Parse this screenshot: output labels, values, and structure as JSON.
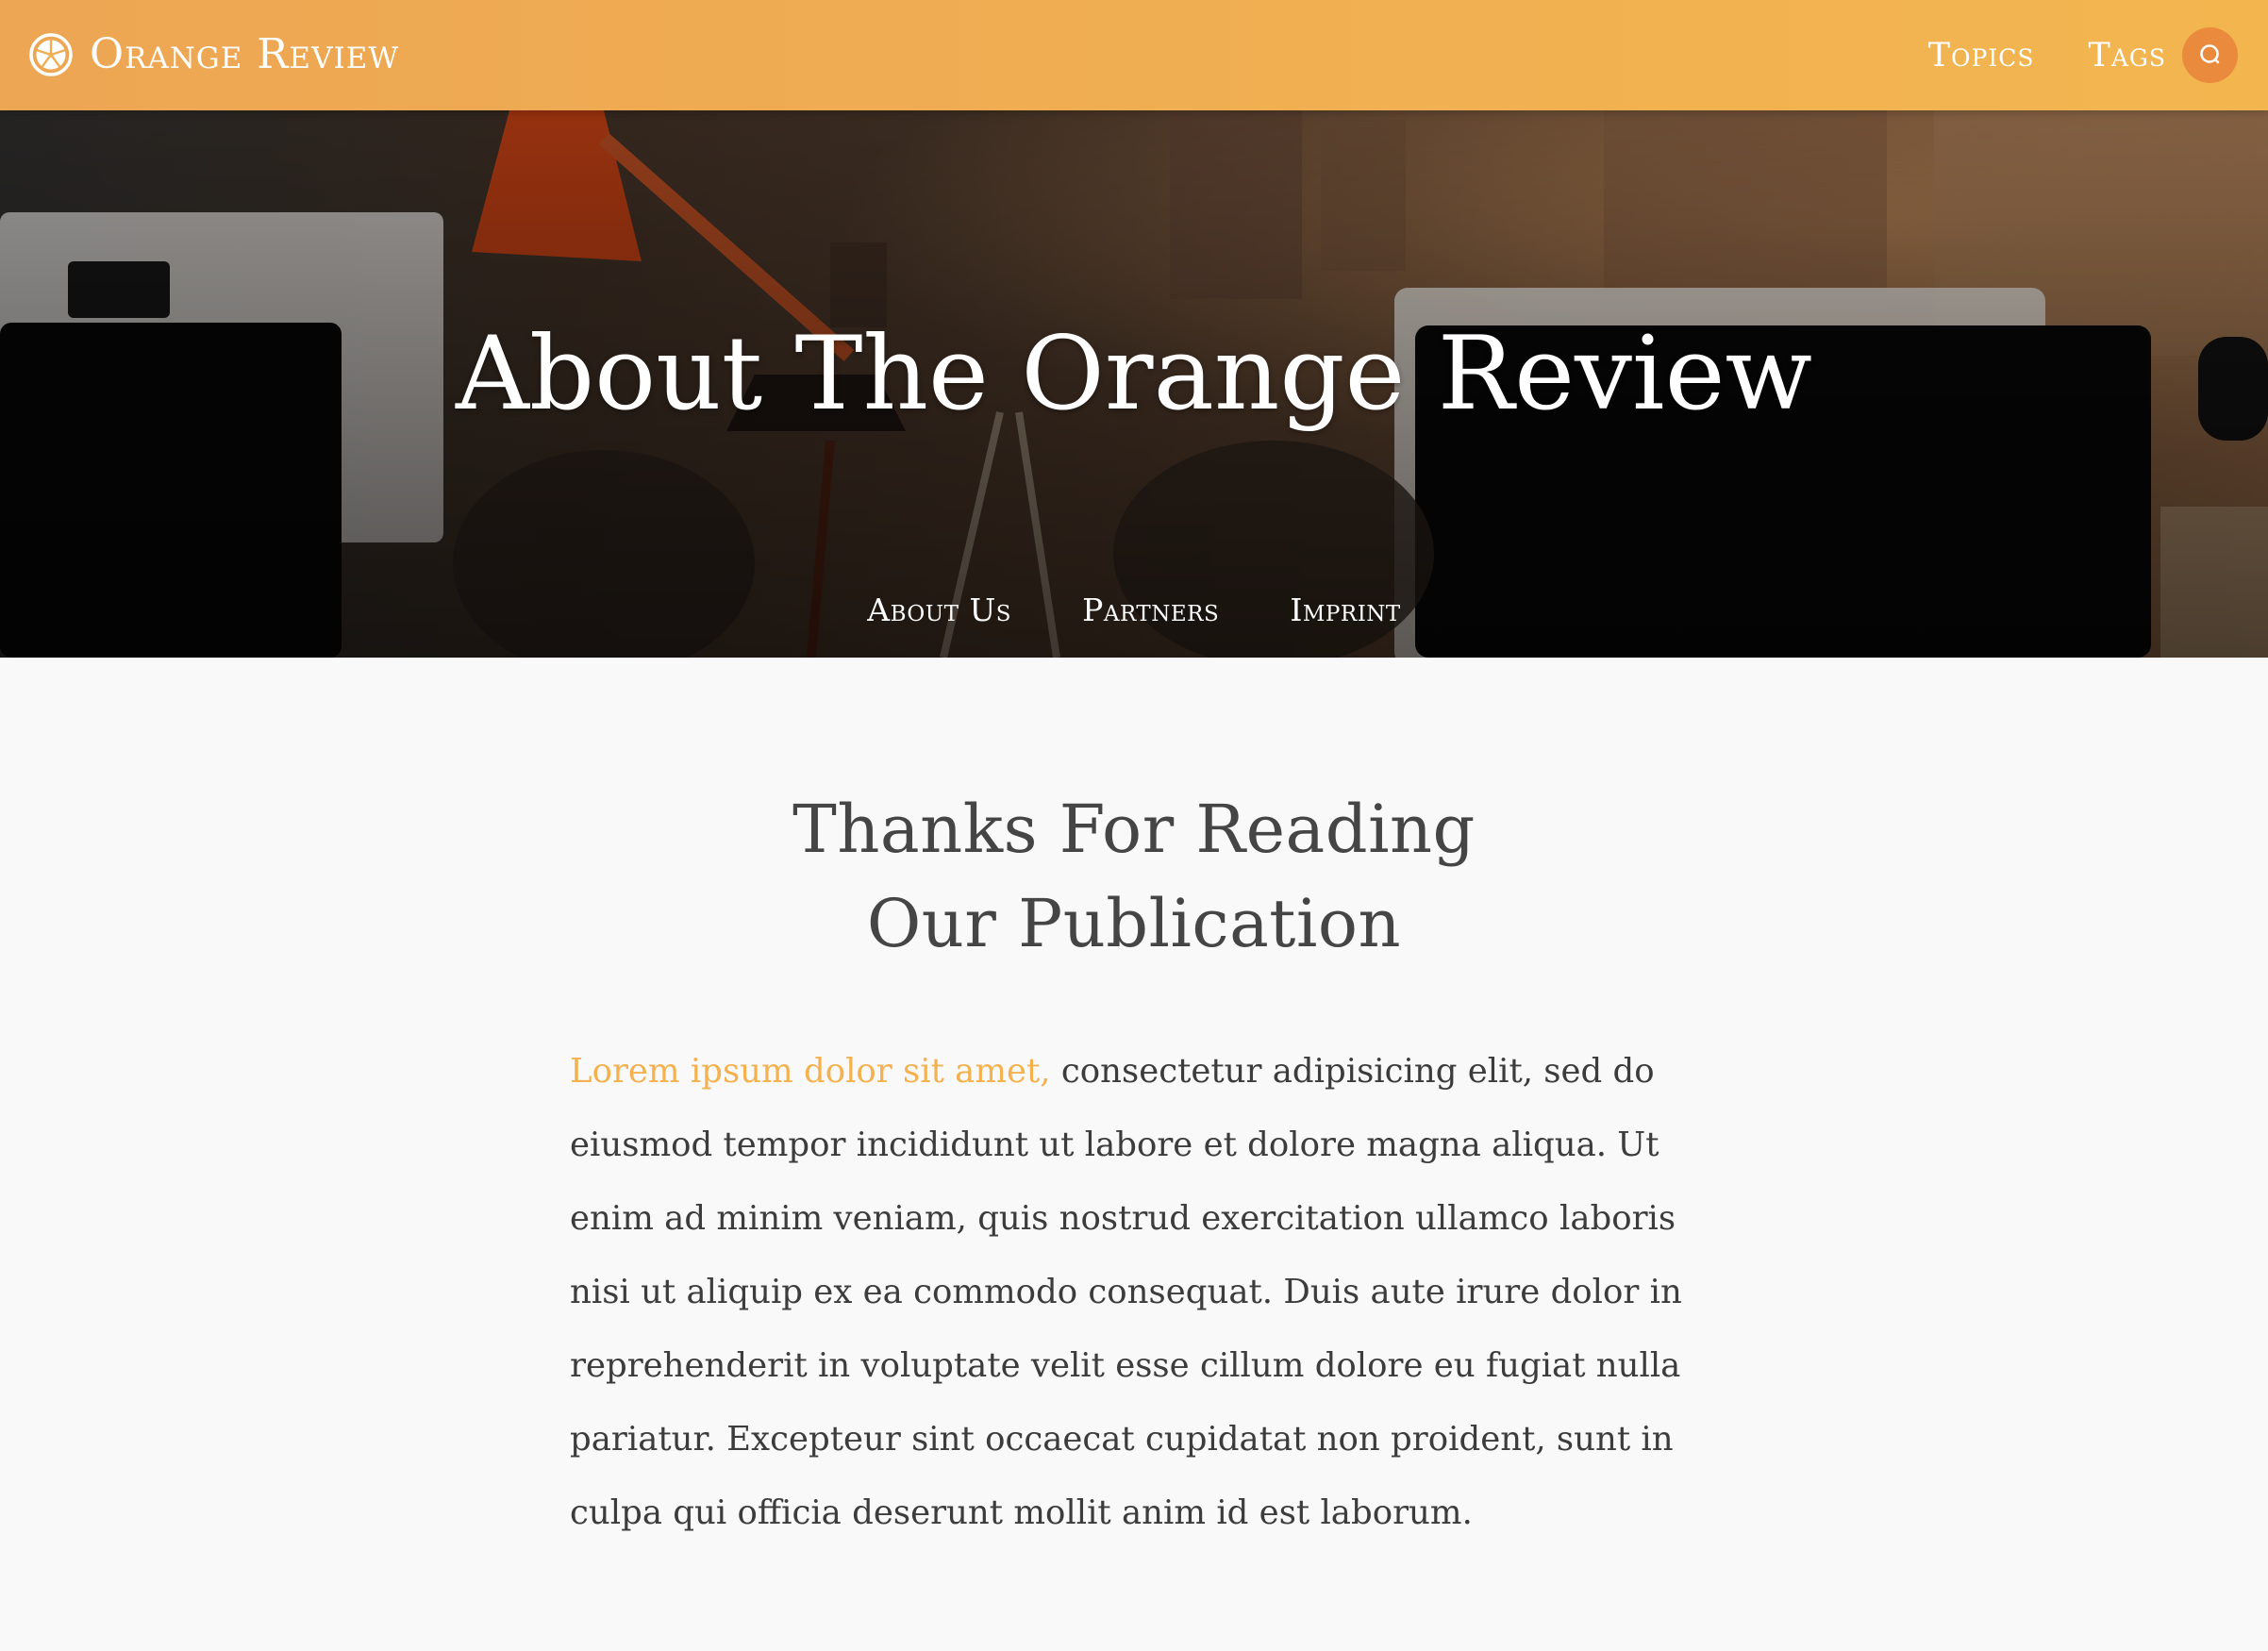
{
  "colors": {
    "brand_orange": "#f0ad52",
    "search_button": "#ea8a3d",
    "highlight_text": "#f3b24f",
    "page_background": "#f9f9f9",
    "body_text": "#3c3c3c"
  },
  "header": {
    "logo_icon": "orange-slice-icon",
    "brand_name": "Orange Review",
    "nav": [
      {
        "label": "Topics"
      },
      {
        "label": "Tags"
      }
    ],
    "search_icon": "search-icon"
  },
  "hero": {
    "title": "About The Orange Review",
    "subnav": [
      {
        "label": "About Us"
      },
      {
        "label": "Partners"
      },
      {
        "label": "Imprint"
      }
    ]
  },
  "main": {
    "heading_line1": "Thanks For Reading",
    "heading_line2": "Our Publication",
    "intro_highlight": "Lorem ipsum dolor sit amet,",
    "intro_rest": " consectetur adipisicing elit, sed do eiusmod tempor incididunt ut labore et dolore magna aliqua. Ut enim ad minim veniam, quis nostrud exercitation ullamco laboris nisi ut aliquip ex ea commodo consequat. Duis aute irure dolor in reprehenderit in voluptate velit esse cillum dolore eu fugiat nulla pariatur. Excepteur sint occaecat cupidatat non proident, sunt in culpa qui officia deserunt mollit anim id est laborum."
  }
}
